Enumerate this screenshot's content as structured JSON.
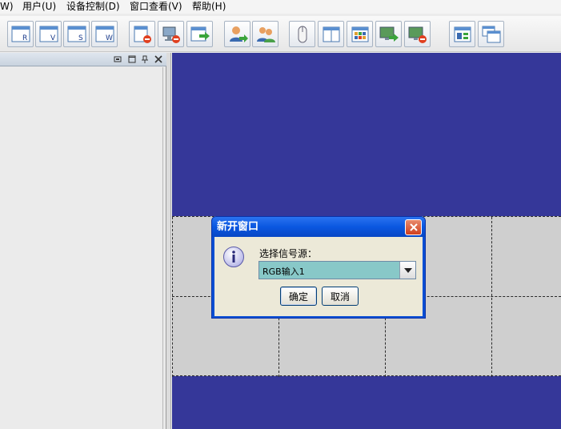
{
  "menu": {
    "items": [
      "W)",
      "用户(U)",
      "设备控制(D)",
      "窗口查看(V)",
      "帮助(H)"
    ]
  },
  "toolbar": {
    "buttons": [
      "window-r-icon",
      "window-v-icon",
      "window-s-icon",
      "window-w-icon",
      "window-delete-icon",
      "monitor-delete-icon",
      "export-window-icon",
      "user-icon",
      "users-icon",
      "mouse-icon",
      "split-view-icon",
      "grid-layout-icon",
      "screen-export-icon",
      "screen-delete-icon",
      "layout-window-icon",
      "cascade-windows-icon"
    ]
  },
  "dock": {
    "controls": [
      "restore-icon",
      "maximize-icon",
      "pin-icon",
      "close-icon"
    ]
  },
  "dialog": {
    "title": "新开窗口",
    "label": "选择信号源：",
    "selected_source": "RGB输入1",
    "ok_label": "确定",
    "cancel_label": "取消"
  },
  "colors": {
    "wall_background": "#353799",
    "grid_background": "#cfcfcf",
    "dialog_title": "#0a57e0",
    "combo_background": "#88c8c8"
  }
}
